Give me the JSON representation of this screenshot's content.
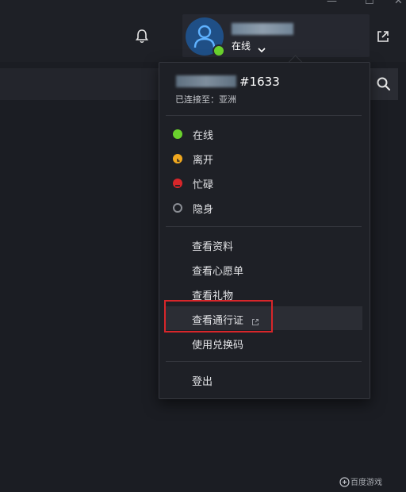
{
  "window": {
    "minimize_glyph": "—",
    "maximize_glyph": "☐",
    "close_glyph": "✕"
  },
  "header": {
    "status_label": "在线",
    "status_color": "#6ad12d",
    "avatar_color": "#1f4f86",
    "icons": [
      "bell-icon",
      "avatar-icon",
      "chevron-down-icon",
      "external-link-icon",
      "search-icon"
    ]
  },
  "menu": {
    "user_tag": "#1633",
    "connected_text": "已连接至：亚洲",
    "statuses": [
      {
        "label": "在线",
        "color": "#6ad12d",
        "icon": "online-dot-icon"
      },
      {
        "label": "离开",
        "color": "#f0a81f",
        "icon": "away-clock-icon"
      },
      {
        "label": "忙碌",
        "color": "#d8262a",
        "icon": "busy-minus-icon"
      },
      {
        "label": "隐身",
        "color": "#8a8d94",
        "icon": "invisible-ring-icon"
      }
    ],
    "items": [
      {
        "label": "查看资料"
      },
      {
        "label": "查看心愿单"
      },
      {
        "label": "查看礼物"
      },
      {
        "label": "查看通行证",
        "icon": "external-link-icon",
        "highlighted": true
      },
      {
        "label": "使用兑换码"
      }
    ],
    "logout_label": "登出"
  },
  "watermark": "百度游戏",
  "highlight_color": "#d8262a"
}
